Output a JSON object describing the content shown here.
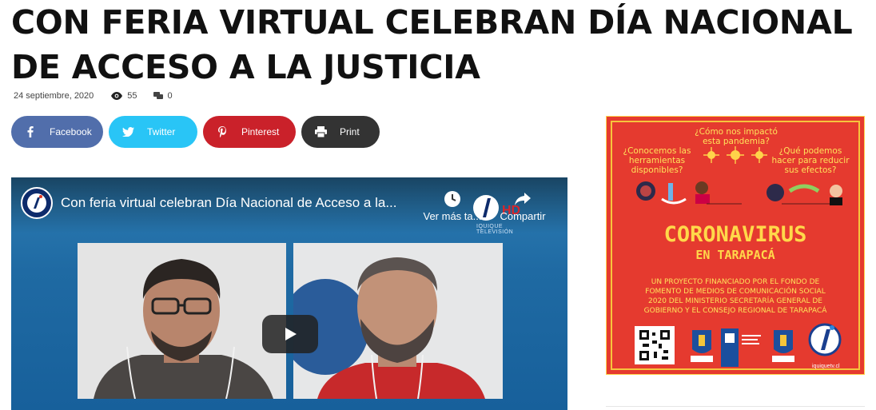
{
  "article": {
    "title": "CON FERIA VIRTUAL CELEBRAN DÍA NACIONAL DE ACCESO A LA JUSTICIA",
    "date": "24 septiembre, 2020",
    "views": "55",
    "comments": "0"
  },
  "share": {
    "facebook": "Facebook",
    "twitter": "Twitter",
    "pinterest": "Pinterest",
    "print": "Print"
  },
  "video": {
    "title": "Con feria virtual celebran Día Nacional de Acceso a la...",
    "watch_later": "Ver más ta...",
    "share_label": "Compartir",
    "watermark": "IQUIQUE TELEVISIÓN"
  },
  "ad": {
    "q1": "¿Cómo nos impactó esta pandemia?",
    "q2": "¿Conocemos las herramientas disponibles?",
    "q3": "¿Qué podemos hacer para reducir sus efectos?",
    "headline": "CORONAVIRUS",
    "subheadline": "EN TARAPACÁ",
    "funding": "UN PROYECTO FINANCIADO POR EL FONDO DE FOMENTO DE MEDIOS DE COMUNICACIÓN SOCIAL 2020 DEL MINISTERIO SECRETARÍA GENERAL DE GOBIERNO Y EL CONSEJO REGIONAL DE TARAPACÁ",
    "site": "iquiquetv.cl"
  }
}
